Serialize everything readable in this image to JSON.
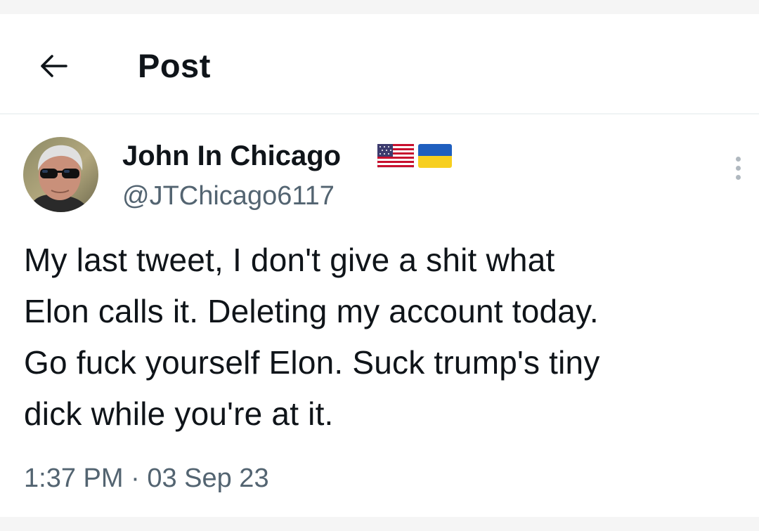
{
  "header": {
    "title": "Post",
    "back_icon": "arrow-left-icon"
  },
  "post": {
    "author": {
      "display_name": "John In Chicago",
      "handle": "@JTChicago6117",
      "badges": [
        "us-flag-icon",
        "ukraine-flag-icon"
      ],
      "avatar": "avatar-photo"
    },
    "text_lines": [
      "My last tweet, I don't give a shit what",
      "Elon calls it. Deleting my account today.",
      "Go fuck yourself Elon. Suck trump's tiny",
      "dick while you're at it."
    ],
    "time": "1:37 PM",
    "separator": "·",
    "date": "03 Sep 23",
    "more_icon": "more-vertical-icon"
  },
  "colors": {
    "text": "#0f1419",
    "secondary": "#536471",
    "divider": "#eff3f4",
    "background": "#ffffff"
  }
}
